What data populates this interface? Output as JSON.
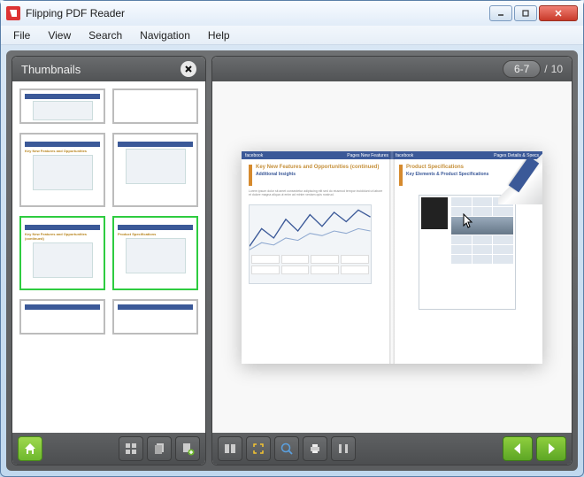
{
  "window": {
    "title": "Flipping PDF Reader"
  },
  "menu": {
    "file": "File",
    "view": "View",
    "search": "Search",
    "navigation": "Navigation",
    "help": "Help"
  },
  "thumbnails_panel": {
    "title": "Thumbnails"
  },
  "pager": {
    "current_range": "6-7",
    "separator": "/",
    "total": "10"
  },
  "document": {
    "left_page": {
      "brand": "facebook",
      "breadcrumb": "Pages New Features",
      "heading": "Key New Features and Opportunities (continued)",
      "subheading": "Additional Insights"
    },
    "right_page": {
      "brand": "facebook",
      "breadcrumb": "Pages Details & Specs",
      "heading": "Product Specifications",
      "subheading": "Key Elements & Product Specifications"
    }
  },
  "thumbs": {
    "t3_hl": "Key New Features and Opportunities",
    "t5_hl": "Key New Features and Opportunities (continued)",
    "t6_hl": "Product Specifications"
  },
  "icons": {
    "home": "home",
    "grid": "grid",
    "stack": "stack",
    "add": "add",
    "layout": "layout",
    "fit": "fit",
    "zoom": "zoom",
    "print": "print",
    "columns": "columns",
    "prev": "prev",
    "next": "next"
  }
}
